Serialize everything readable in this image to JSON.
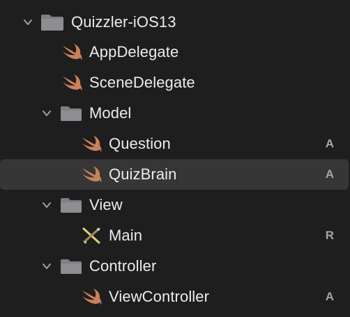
{
  "navigator": {
    "rows": [
      {
        "label": "Quizzler-iOS13",
        "kind": "folder",
        "expanded": true,
        "level": 0,
        "status": ""
      },
      {
        "label": "AppDelegate",
        "kind": "swift",
        "level": 1,
        "status": ""
      },
      {
        "label": "SceneDelegate",
        "kind": "swift",
        "level": 1,
        "status": ""
      },
      {
        "label": "Model",
        "kind": "folder",
        "expanded": true,
        "level": 1,
        "status": ""
      },
      {
        "label": "Question",
        "kind": "swift",
        "level": 2,
        "status": "A"
      },
      {
        "label": "QuizBrain",
        "kind": "swift",
        "level": 2,
        "status": "A",
        "selected": true
      },
      {
        "label": "View",
        "kind": "folder",
        "expanded": true,
        "level": 1,
        "status": ""
      },
      {
        "label": "Main",
        "kind": "storyboard",
        "level": 2,
        "status": "R"
      },
      {
        "label": "Controller",
        "kind": "folder",
        "expanded": true,
        "level": 1,
        "status": ""
      },
      {
        "label": "ViewController",
        "kind": "swift",
        "level": 2,
        "status": "A"
      }
    ]
  },
  "colors": {
    "background": "#1e1e1e",
    "selection": "#363636",
    "swift_icon": "#c9825a",
    "folder_icon": "#8a8a8e",
    "status_text": "#a6a6a6"
  }
}
